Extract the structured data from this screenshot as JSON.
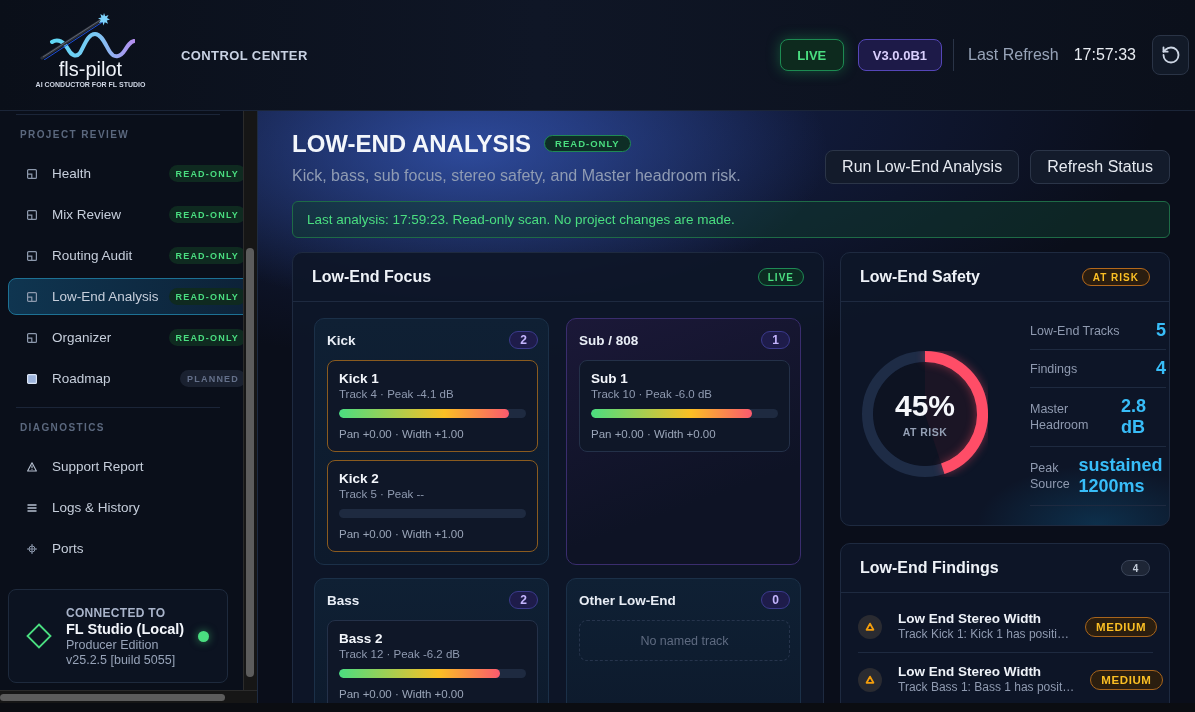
{
  "header": {
    "logo": {
      "name": "fls-pilot",
      "tagline": "AI CONDUCTOR FOR FL STUDIO"
    },
    "title": "CONTROL CENTER",
    "status": "LIVE",
    "version": "V3.0.0B1",
    "refresh_label": "Last Refresh",
    "refresh_time": "17:57:33"
  },
  "sidebar": {
    "sections": [
      {
        "title": "PROJECT REVIEW",
        "items": [
          {
            "label": "Health",
            "badge": {
              "text": "READ-ONLY",
              "kind": "ready"
            },
            "selected": false
          },
          {
            "label": "Mix Review",
            "badge": {
              "text": "READ-ONLY",
              "kind": "ready"
            },
            "selected": false
          },
          {
            "label": "Routing Audit",
            "badge": {
              "text": "READ-ONLY",
              "kind": "ready"
            },
            "selected": false
          },
          {
            "label": "Low-End Analysis",
            "badge": {
              "text": "READ-ONLY",
              "kind": "ready"
            },
            "selected": true
          },
          {
            "label": "Organizer",
            "badge": {
              "text": "READ-ONLY",
              "kind": "ready"
            },
            "selected": false
          },
          {
            "label": "Roadmap",
            "badge": {
              "text": "PLANNED",
              "kind": "planned"
            },
            "selected": false
          }
        ]
      },
      {
        "title": "DIAGNOSTICS",
        "items": [
          {
            "label": "Support Report",
            "selected": false
          },
          {
            "label": "Logs & History",
            "selected": false
          },
          {
            "label": "Ports",
            "selected": false
          }
        ]
      }
    ],
    "connection": {
      "heading": "CONNECTED TO",
      "name": "FL Studio (Local)",
      "edition": "Producer Edition",
      "version": "v25.2.5 [build 5055]",
      "online": true
    }
  },
  "page": {
    "title": "LOW-END ANALYSIS",
    "badge": "READ-ONLY",
    "subtitle": "Kick, bass, sub focus, stereo safety, and Master headroom risk.",
    "actions": [
      "Run Low-End Analysis",
      "Refresh Status"
    ],
    "notice": "Last analysis: 17:59:23. Read-only scan. No project changes are made."
  },
  "focus": {
    "title": "Low-End Focus",
    "badge": "LIVE",
    "groups": [
      {
        "name": "Kick",
        "count": "2",
        "highlighted": false,
        "tracks": [
          {
            "name": "Kick 1",
            "meta": "Track 4 · Peak -4.1 dB",
            "level": 0.91,
            "flagged": true,
            "detail": "Pan +0.00 · Width +1.00"
          },
          {
            "name": "Kick 2",
            "meta": "Track 5 · Peak --",
            "flagged": true,
            "detail": "Pan +0.00 · Width +1.00"
          }
        ]
      },
      {
        "name": "Sub / 808",
        "count": "1",
        "highlighted": true,
        "tracks": [
          {
            "name": "Sub 1",
            "meta": "Track 10 · Peak -6.0 dB",
            "level": 0.86,
            "flagged": false,
            "detail": "Pan +0.00 · Width +0.00"
          }
        ]
      },
      {
        "name": "Bass",
        "count": "2",
        "highlighted": false,
        "tracks": [
          {
            "name": "Bass 2",
            "meta": "Track 12 · Peak -6.2 dB",
            "level": 0.86,
            "flagged": false,
            "detail": "Pan +0.00 · Width +0.00"
          }
        ]
      },
      {
        "name": "Other Low-End",
        "count": "0",
        "highlighted": false,
        "empty_text": "No named track"
      }
    ]
  },
  "safety": {
    "title": "Low-End Safety",
    "badge": "AT RISK",
    "gauge": {
      "level": 0.45,
      "value": "45%",
      "label": "AT RISK"
    },
    "stats": [
      {
        "label": "Low-End Tracks",
        "value": "5"
      },
      {
        "label": "Findings",
        "value": "4"
      },
      {
        "label": "Master Headroom",
        "value": "2.8 dB"
      },
      {
        "label": "Peak Source",
        "value": "sustained 1200ms"
      }
    ]
  },
  "findings": {
    "title": "Low-End Findings",
    "count": "4",
    "items": [
      {
        "title": "Low End Stereo Width",
        "description": "Track Kick 1: Kick 1 has positi…",
        "severity": "MEDIUM"
      },
      {
        "title": "Low End Stereo Width",
        "description": "Track Bass 1: Bass 1 has posit…",
        "severity": "MEDIUM"
      }
    ]
  }
}
